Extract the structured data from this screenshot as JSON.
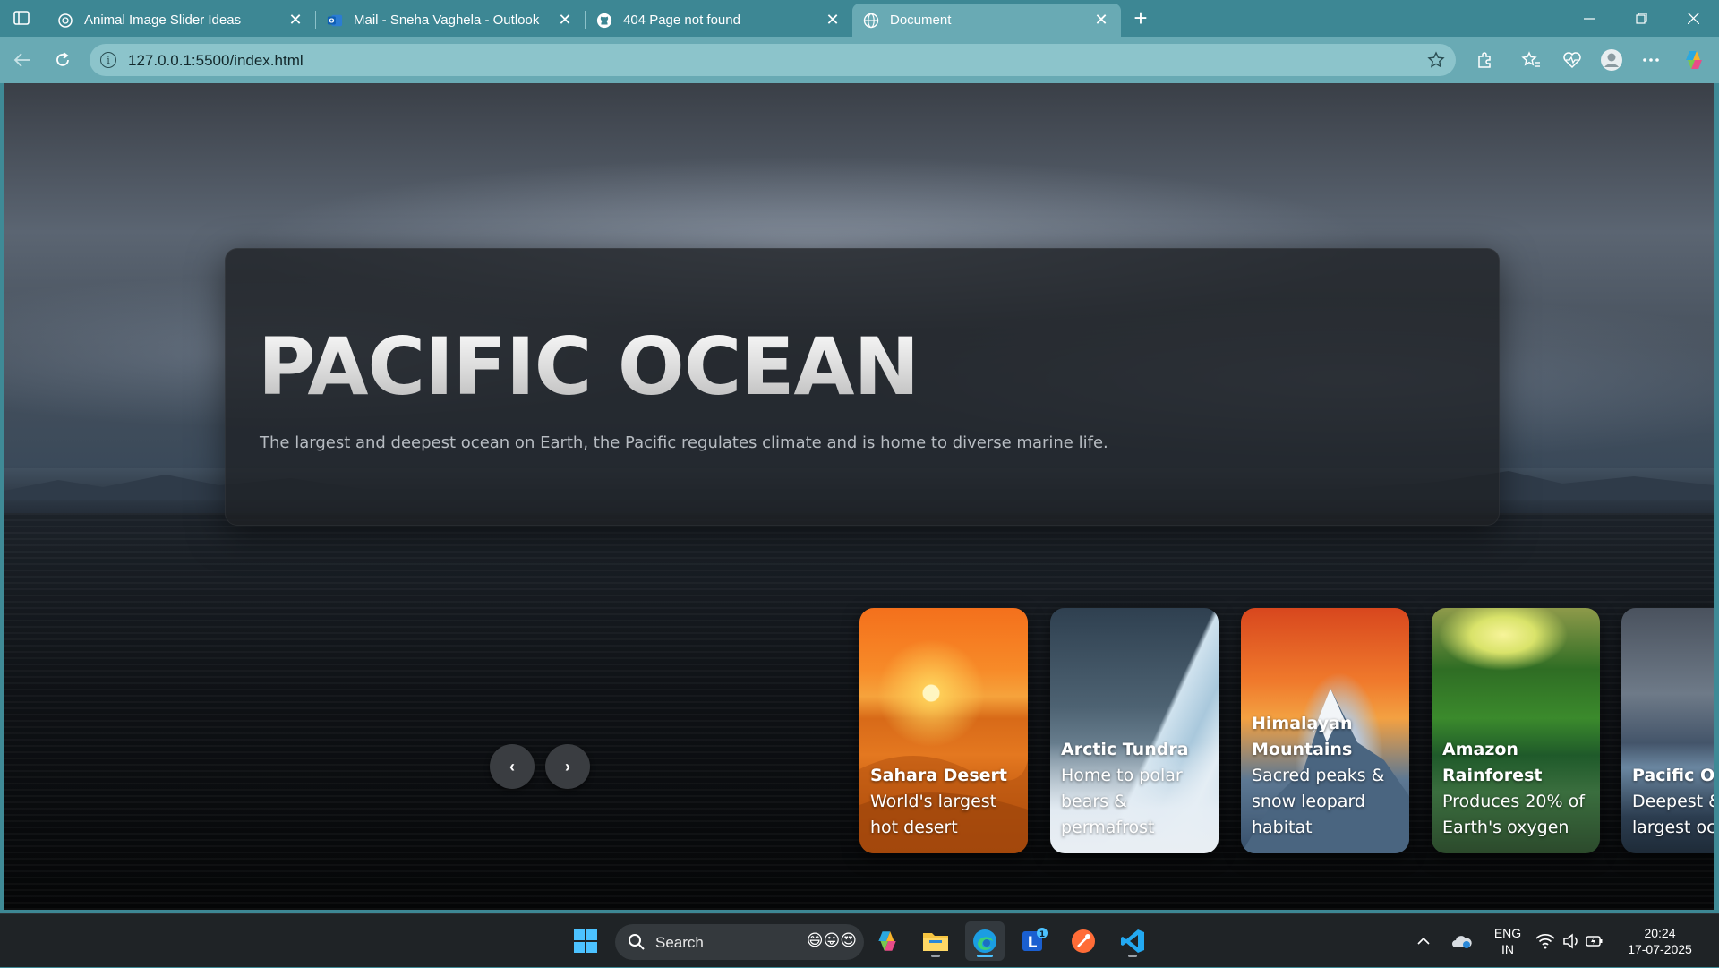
{
  "browser": {
    "tabs": [
      {
        "title": "Animal Image Slider Ideas",
        "icon": "chatgpt-icon",
        "active": false
      },
      {
        "title": "Mail - Sneha Vaghela - Outlook",
        "icon": "outlook-icon",
        "active": false
      },
      {
        "title": "404 Page not found",
        "icon": "github-icon",
        "active": false
      },
      {
        "title": "Document",
        "icon": "globe-icon",
        "active": true
      }
    ],
    "close_glyph": "✕",
    "new_tab_glyph": "+",
    "url": "127.0.0.1:5500/index.html",
    "info_glyph": "i"
  },
  "hero": {
    "title": "PACIFIC OCEAN",
    "description": "The largest and deepest ocean on Earth, the Pacific regulates climate and is home to diverse marine life."
  },
  "slider": {
    "prev_glyph": "‹",
    "next_glyph": "›",
    "cards": [
      {
        "title": "Sahara Desert",
        "subtitle": "World's largest hot desert"
      },
      {
        "title": "Arctic Tundra",
        "subtitle": "Home to polar bears & permafrost"
      },
      {
        "title": "Himalayan Mountains",
        "subtitle": "Sacred peaks & snow leopard habitat"
      },
      {
        "title": "Amazon Rainforest",
        "subtitle": "Produces 20% of Earth's oxygen"
      },
      {
        "title": "Pacific Oc",
        "subtitle": "Deepest & largest oc Earth"
      }
    ]
  },
  "taskbar": {
    "search_label": "Search",
    "search_emoji": "😄😛😍",
    "notification_badge": "1",
    "language": "ENG",
    "region": "IN",
    "time": "20:24",
    "date": "17-07-2025"
  },
  "colors": {
    "tab_strip": "#3d8794",
    "address_bar": "#69aab4",
    "hero_panel": "#1e2024",
    "taskbar": "#1f2326"
  }
}
